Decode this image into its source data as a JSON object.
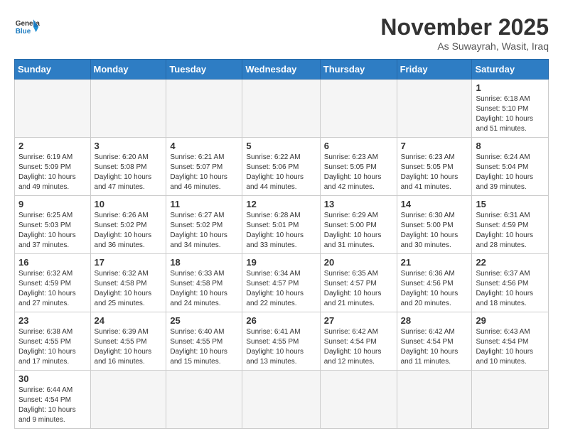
{
  "header": {
    "logo_general": "General",
    "logo_blue": "Blue",
    "month_year": "November 2025",
    "location": "As Suwayrah, Wasit, Iraq"
  },
  "weekdays": [
    "Sunday",
    "Monday",
    "Tuesday",
    "Wednesday",
    "Thursday",
    "Friday",
    "Saturday"
  ],
  "weeks": [
    [
      {
        "day": "",
        "info": ""
      },
      {
        "day": "",
        "info": ""
      },
      {
        "day": "",
        "info": ""
      },
      {
        "day": "",
        "info": ""
      },
      {
        "day": "",
        "info": ""
      },
      {
        "day": "",
        "info": ""
      },
      {
        "day": "1",
        "info": "Sunrise: 6:18 AM\nSunset: 5:10 PM\nDaylight: 10 hours and 51 minutes."
      }
    ],
    [
      {
        "day": "2",
        "info": "Sunrise: 6:19 AM\nSunset: 5:09 PM\nDaylight: 10 hours and 49 minutes."
      },
      {
        "day": "3",
        "info": "Sunrise: 6:20 AM\nSunset: 5:08 PM\nDaylight: 10 hours and 47 minutes."
      },
      {
        "day": "4",
        "info": "Sunrise: 6:21 AM\nSunset: 5:07 PM\nDaylight: 10 hours and 46 minutes."
      },
      {
        "day": "5",
        "info": "Sunrise: 6:22 AM\nSunset: 5:06 PM\nDaylight: 10 hours and 44 minutes."
      },
      {
        "day": "6",
        "info": "Sunrise: 6:23 AM\nSunset: 5:05 PM\nDaylight: 10 hours and 42 minutes."
      },
      {
        "day": "7",
        "info": "Sunrise: 6:23 AM\nSunset: 5:05 PM\nDaylight: 10 hours and 41 minutes."
      },
      {
        "day": "8",
        "info": "Sunrise: 6:24 AM\nSunset: 5:04 PM\nDaylight: 10 hours and 39 minutes."
      }
    ],
    [
      {
        "day": "9",
        "info": "Sunrise: 6:25 AM\nSunset: 5:03 PM\nDaylight: 10 hours and 37 minutes."
      },
      {
        "day": "10",
        "info": "Sunrise: 6:26 AM\nSunset: 5:02 PM\nDaylight: 10 hours and 36 minutes."
      },
      {
        "day": "11",
        "info": "Sunrise: 6:27 AM\nSunset: 5:02 PM\nDaylight: 10 hours and 34 minutes."
      },
      {
        "day": "12",
        "info": "Sunrise: 6:28 AM\nSunset: 5:01 PM\nDaylight: 10 hours and 33 minutes."
      },
      {
        "day": "13",
        "info": "Sunrise: 6:29 AM\nSunset: 5:00 PM\nDaylight: 10 hours and 31 minutes."
      },
      {
        "day": "14",
        "info": "Sunrise: 6:30 AM\nSunset: 5:00 PM\nDaylight: 10 hours and 30 minutes."
      },
      {
        "day": "15",
        "info": "Sunrise: 6:31 AM\nSunset: 4:59 PM\nDaylight: 10 hours and 28 minutes."
      }
    ],
    [
      {
        "day": "16",
        "info": "Sunrise: 6:32 AM\nSunset: 4:59 PM\nDaylight: 10 hours and 27 minutes."
      },
      {
        "day": "17",
        "info": "Sunrise: 6:32 AM\nSunset: 4:58 PM\nDaylight: 10 hours and 25 minutes."
      },
      {
        "day": "18",
        "info": "Sunrise: 6:33 AM\nSunset: 4:58 PM\nDaylight: 10 hours and 24 minutes."
      },
      {
        "day": "19",
        "info": "Sunrise: 6:34 AM\nSunset: 4:57 PM\nDaylight: 10 hours and 22 minutes."
      },
      {
        "day": "20",
        "info": "Sunrise: 6:35 AM\nSunset: 4:57 PM\nDaylight: 10 hours and 21 minutes."
      },
      {
        "day": "21",
        "info": "Sunrise: 6:36 AM\nSunset: 4:56 PM\nDaylight: 10 hours and 20 minutes."
      },
      {
        "day": "22",
        "info": "Sunrise: 6:37 AM\nSunset: 4:56 PM\nDaylight: 10 hours and 18 minutes."
      }
    ],
    [
      {
        "day": "23",
        "info": "Sunrise: 6:38 AM\nSunset: 4:55 PM\nDaylight: 10 hours and 17 minutes."
      },
      {
        "day": "24",
        "info": "Sunrise: 6:39 AM\nSunset: 4:55 PM\nDaylight: 10 hours and 16 minutes."
      },
      {
        "day": "25",
        "info": "Sunrise: 6:40 AM\nSunset: 4:55 PM\nDaylight: 10 hours and 15 minutes."
      },
      {
        "day": "26",
        "info": "Sunrise: 6:41 AM\nSunset: 4:55 PM\nDaylight: 10 hours and 13 minutes."
      },
      {
        "day": "27",
        "info": "Sunrise: 6:42 AM\nSunset: 4:54 PM\nDaylight: 10 hours and 12 minutes."
      },
      {
        "day": "28",
        "info": "Sunrise: 6:42 AM\nSunset: 4:54 PM\nDaylight: 10 hours and 11 minutes."
      },
      {
        "day": "29",
        "info": "Sunrise: 6:43 AM\nSunset: 4:54 PM\nDaylight: 10 hours and 10 minutes."
      }
    ],
    [
      {
        "day": "30",
        "info": "Sunrise: 6:44 AM\nSunset: 4:54 PM\nDaylight: 10 hours and 9 minutes."
      },
      {
        "day": "",
        "info": ""
      },
      {
        "day": "",
        "info": ""
      },
      {
        "day": "",
        "info": ""
      },
      {
        "day": "",
        "info": ""
      },
      {
        "day": "",
        "info": ""
      },
      {
        "day": "",
        "info": ""
      }
    ]
  ]
}
